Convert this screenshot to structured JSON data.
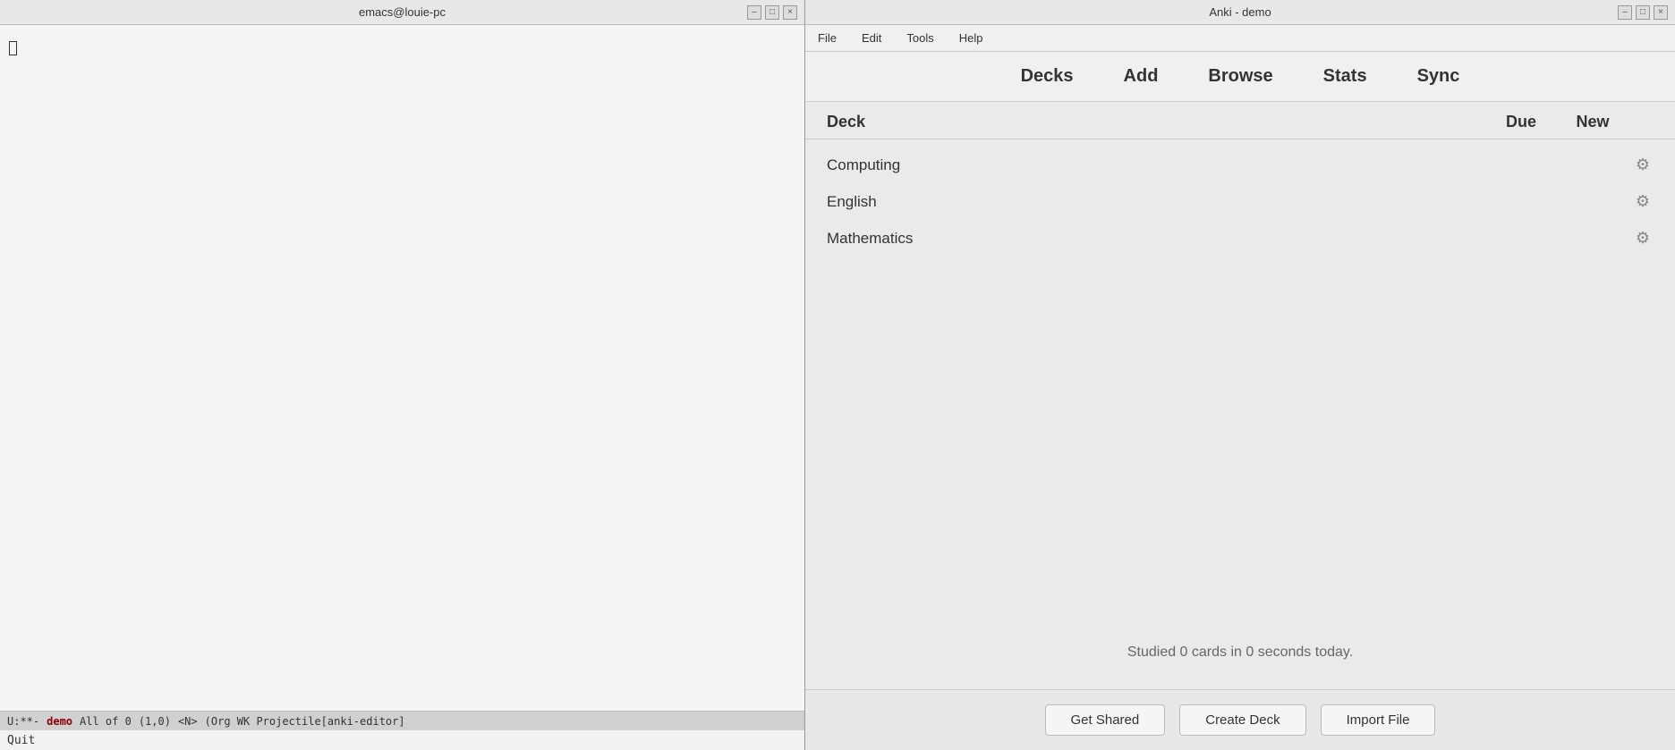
{
  "emacs": {
    "title": "emacs@louie-pc",
    "statusbar": {
      "mode_indicator": "U:**-",
      "buffer_name": "demo",
      "position_label": "All of 0",
      "cursor_pos": "(1,0)",
      "extra": "<N>",
      "mode_line": "(Org WK Projectile[anki-editor]"
    },
    "quit_label": "Quit",
    "titlebar_buttons": [
      "-",
      "□",
      "×"
    ]
  },
  "anki": {
    "title": "Anki - demo",
    "titlebar_buttons": [
      "-",
      "□",
      "×"
    ],
    "menu": {
      "items": [
        "File",
        "Edit",
        "Tools",
        "Help"
      ]
    },
    "toolbar": {
      "items": [
        "Decks",
        "Add",
        "Browse",
        "Stats",
        "Sync"
      ]
    },
    "deck_list": {
      "header": {
        "deck_col": "Deck",
        "due_col": "Due",
        "new_col": "New"
      },
      "rows": [
        {
          "name": "Computing",
          "due": "",
          "new": ""
        },
        {
          "name": "English",
          "due": "",
          "new": ""
        },
        {
          "name": "Mathematics",
          "due": "",
          "new": ""
        }
      ]
    },
    "studied_text": "Studied 0 cards in 0 seconds today.",
    "footer": {
      "get_shared": "Get Shared",
      "create_deck": "Create Deck",
      "import_file": "Import File"
    }
  }
}
